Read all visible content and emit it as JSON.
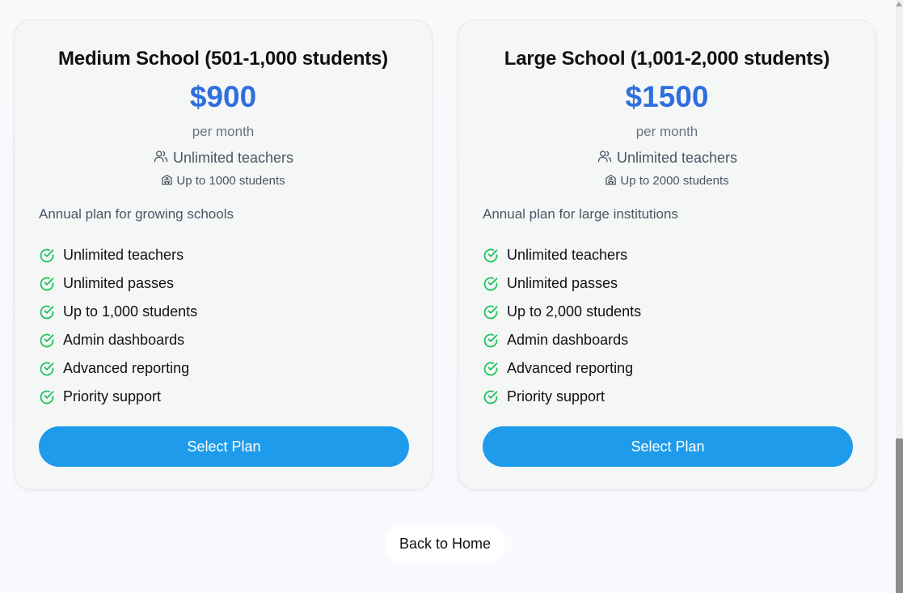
{
  "plans": [
    {
      "title": "Medium School (501-1,000 students)",
      "price": "$900",
      "period": "per month",
      "teachers": "Unlimited teachers",
      "students": "Up to 1000 students",
      "description": "Annual plan for growing schools",
      "features": [
        "Unlimited teachers",
        "Unlimited passes",
        "Up to 1,000 students",
        "Admin dashboards",
        "Advanced reporting",
        "Priority support"
      ],
      "button_label": "Select Plan"
    },
    {
      "title": "Large School (1,001-2,000 students)",
      "price": "$1500",
      "period": "per month",
      "teachers": "Unlimited teachers",
      "students": "Up to 2000 students",
      "description": "Annual plan for large institutions",
      "features": [
        "Unlimited teachers",
        "Unlimited passes",
        "Up to 2,000 students",
        "Admin dashboards",
        "Advanced reporting",
        "Priority support"
      ],
      "button_label": "Select Plan"
    }
  ],
  "back_label": "Back to Home",
  "icons": {
    "teachers": "users-icon",
    "students": "school-icon",
    "feature": "check-circle-icon"
  },
  "colors": {
    "price": "#2f6fdd",
    "button": "#1e9bea",
    "check": "#22c55e",
    "card_bg": "#f5f7f7"
  }
}
